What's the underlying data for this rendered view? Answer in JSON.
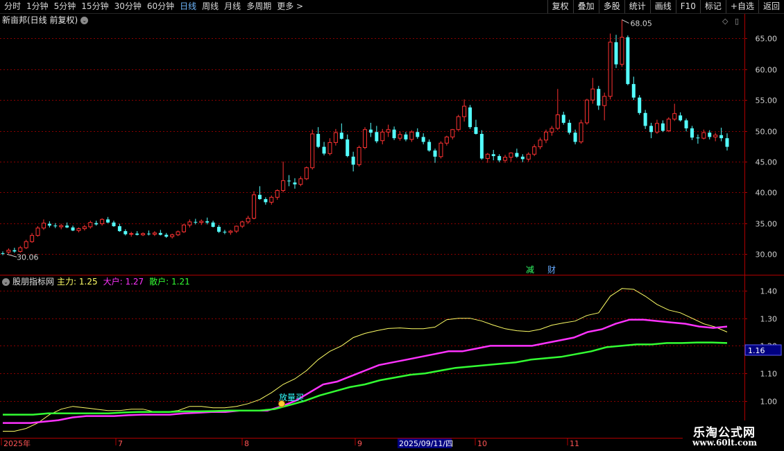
{
  "toolbar": {
    "periods": [
      {
        "label": "分时",
        "active": false
      },
      {
        "label": "1分钟",
        "active": false
      },
      {
        "label": "5分钟",
        "active": false
      },
      {
        "label": "15分钟",
        "active": false
      },
      {
        "label": "30分钟",
        "active": false
      },
      {
        "label": "60分钟",
        "active": false
      },
      {
        "label": "日线",
        "active": true
      },
      {
        "label": "周线",
        "active": false
      },
      {
        "label": "月线",
        "active": false
      },
      {
        "label": "多周期",
        "active": false
      },
      {
        "label": "更多 >",
        "active": false
      }
    ],
    "actions": [
      "复权",
      "叠加",
      "多股",
      "统计",
      "画线",
      "F10",
      "标记",
      "+自选",
      "返回"
    ]
  },
  "stock": {
    "title": "新亩邦(日线 前复权)",
    "high_label": "68.05",
    "low_label": "30.06",
    "event_labels": [
      "减",
      "财"
    ],
    "yaxis_ticks": [
      65,
      60,
      55,
      50,
      45,
      40,
      35,
      30
    ],
    "yaxis_tick_labels": [
      "65.00",
      "60.00",
      "55.00",
      "50.00",
      "45.00",
      "40.00",
      "35.00",
      "30.00"
    ]
  },
  "indicator": {
    "name": "股朋指标网",
    "series_labels": [
      {
        "label": "主力: 1.25",
        "color": "#ffff66"
      },
      {
        "label": "大户: 1.27",
        "color": "#ff33ff"
      },
      {
        "label": "散户: 1.21",
        "color": "#33ff33"
      }
    ],
    "yaxis_ticks": [
      1.4,
      1.3,
      1.2,
      1.1,
      1.0
    ],
    "yaxis_tick_labels": [
      "1.40",
      "1.30",
      "1.20",
      "1.10",
      "1.00"
    ],
    "current_value": "1.16",
    "signal_label": "放量买"
  },
  "xaxis": {
    "labels": [
      "2025年",
      "7",
      "8",
      "9",
      "2025/09/11/四",
      "10",
      "11"
    ],
    "cursor_label": "2025/09/11/四"
  },
  "watermark": {
    "title": "乐淘公式网",
    "url": "www.60lt.com"
  },
  "colors": {
    "up": "#ff3232",
    "down": "#54ffff",
    "main": "#ffff66",
    "big": "#ff33ff",
    "small": "#33ff33",
    "grid": "#8b0000",
    "axis": "#b00000"
  },
  "chart_data": [
    {
      "type": "candlestick",
      "title": "新亩邦(日线 前复权)",
      "ylim": [
        28.5,
        69
      ],
      "markers": {
        "high": 68.05,
        "low": 30.06
      },
      "candles": [
        [
          30.1,
          30.4,
          29.8,
          30.06
        ],
        [
          30.3,
          30.9,
          30.0,
          30.6
        ],
        [
          30.6,
          31.0,
          30.2,
          30.4
        ],
        [
          30.4,
          31.3,
          30.2,
          31.0
        ],
        [
          31.0,
          32.3,
          30.8,
          32.0
        ],
        [
          32.0,
          33.4,
          31.8,
          33.0
        ],
        [
          33.0,
          34.5,
          32.8,
          34.2
        ],
        [
          34.2,
          35.6,
          33.9,
          35.0
        ],
        [
          34.9,
          35.3,
          34.3,
          34.6
        ],
        [
          34.6,
          35.0,
          34.2,
          34.5
        ],
        [
          34.4,
          34.9,
          34.0,
          34.6
        ],
        [
          34.6,
          35.1,
          34.2,
          34.3
        ],
        [
          34.3,
          34.6,
          33.7,
          33.8
        ],
        [
          33.8,
          34.3,
          33.5,
          34.1
        ],
        [
          34.1,
          34.7,
          33.8,
          34.4
        ],
        [
          34.4,
          35.4,
          34.1,
          35.1
        ],
        [
          35.0,
          35.4,
          34.6,
          34.8
        ],
        [
          34.9,
          35.8,
          34.6,
          35.6
        ],
        [
          35.6,
          36.0,
          35.0,
          35.1
        ],
        [
          35.1,
          35.4,
          34.4,
          34.5
        ],
        [
          34.5,
          34.9,
          33.6,
          33.7
        ],
        [
          33.7,
          34.0,
          33.0,
          33.2
        ],
        [
          33.2,
          33.6,
          32.8,
          33.3
        ],
        [
          33.3,
          33.7,
          33.0,
          33.1
        ],
        [
          33.1,
          33.5,
          32.9,
          33.3
        ],
        [
          33.3,
          33.8,
          33.0,
          33.2
        ],
        [
          33.2,
          33.7,
          32.9,
          33.4
        ],
        [
          33.4,
          33.9,
          33.0,
          33.1
        ],
        [
          33.1,
          33.4,
          32.6,
          32.8
        ],
        [
          32.8,
          33.3,
          32.5,
          33.1
        ],
        [
          33.1,
          33.8,
          32.9,
          33.6
        ],
        [
          33.6,
          34.9,
          33.4,
          34.7
        ],
        [
          34.7,
          35.6,
          34.3,
          35.2
        ],
        [
          35.2,
          35.7,
          34.8,
          35.1
        ],
        [
          35.1,
          35.6,
          34.7,
          35.3
        ],
        [
          35.3,
          35.9,
          34.8,
          35.1
        ],
        [
          35.1,
          35.4,
          34.3,
          34.4
        ],
        [
          34.4,
          34.7,
          33.4,
          33.6
        ],
        [
          33.6,
          33.9,
          33.2,
          33.5
        ],
        [
          33.5,
          33.9,
          33.1,
          33.7
        ],
        [
          33.7,
          34.6,
          33.4,
          34.5
        ],
        [
          34.5,
          35.4,
          34.2,
          35.2
        ],
        [
          35.2,
          36.2,
          34.9,
          35.8
        ],
        [
          35.8,
          40.2,
          35.6,
          39.6
        ],
        [
          39.6,
          41.0,
          38.8,
          38.9
        ],
        [
          38.9,
          39.2,
          38.0,
          38.4
        ],
        [
          38.4,
          39.5,
          38.0,
          39.2
        ],
        [
          39.2,
          40.5,
          38.8,
          40.3
        ],
        [
          40.3,
          45.0,
          40.0,
          41.9
        ],
        [
          41.9,
          42.8,
          41.0,
          41.8
        ],
        [
          41.6,
          42.3,
          40.6,
          41.3
        ],
        [
          41.3,
          42.6,
          41.0,
          42.2
        ],
        [
          42.2,
          44.2,
          42.0,
          44.0
        ],
        [
          44.0,
          50.2,
          43.7,
          49.5
        ],
        [
          49.5,
          50.6,
          47.2,
          47.4
        ],
        [
          47.4,
          48.2,
          46.0,
          46.3
        ],
        [
          46.3,
          48.8,
          46.0,
          48.1
        ],
        [
          48.1,
          50.3,
          47.6,
          49.7
        ],
        [
          49.7,
          51.2,
          48.6,
          48.7
        ],
        [
          48.6,
          49.4,
          45.7,
          45.9
        ],
        [
          45.8,
          46.6,
          43.4,
          44.5
        ],
        [
          44.5,
          47.6,
          44.2,
          47.3
        ],
        [
          47.3,
          50.6,
          47.0,
          50.2
        ],
        [
          50.2,
          51.3,
          49.0,
          49.7
        ],
        [
          49.8,
          50.8,
          48.0,
          48.3
        ],
        [
          48.4,
          50.3,
          47.8,
          49.8
        ],
        [
          49.8,
          51.0,
          49.0,
          50.2
        ],
        [
          50.2,
          50.7,
          48.5,
          48.8
        ],
        [
          48.8,
          49.9,
          48.4,
          49.4
        ],
        [
          49.4,
          49.8,
          48.3,
          48.6
        ],
        [
          48.6,
          50.1,
          48.2,
          49.8
        ],
        [
          49.8,
          50.4,
          48.7,
          49.0
        ],
        [
          49.0,
          49.6,
          47.8,
          48.2
        ],
        [
          48.2,
          48.6,
          46.6,
          46.8
        ],
        [
          46.8,
          47.1,
          44.8,
          45.8
        ],
        [
          45.8,
          48.3,
          45.5,
          48.0
        ],
        [
          48.0,
          49.2,
          47.6,
          49.0
        ],
        [
          49.0,
          50.3,
          48.6,
          50.2
        ],
        [
          50.2,
          52.6,
          50.0,
          52.3
        ],
        [
          52.3,
          55.1,
          51.5,
          54.0
        ],
        [
          53.8,
          54.2,
          50.3,
          50.6
        ],
        [
          50.6,
          51.8,
          49.4,
          49.5
        ],
        [
          49.5,
          50.1,
          45.3,
          45.5
        ],
        [
          45.5,
          46.4,
          44.8,
          46.2
        ],
        [
          46.2,
          46.9,
          45.2,
          45.9
        ],
        [
          45.9,
          46.2,
          44.9,
          45.2
        ],
        [
          45.2,
          46.1,
          44.8,
          45.7
        ],
        [
          45.7,
          46.5,
          45.0,
          46.4
        ],
        [
          46.4,
          47.1,
          45.6,
          45.8
        ],
        [
          45.8,
          46.2,
          44.9,
          45.4
        ],
        [
          45.4,
          46.5,
          45.0,
          46.2
        ],
        [
          46.2,
          47.8,
          45.9,
          47.4
        ],
        [
          47.4,
          48.9,
          47.0,
          48.5
        ],
        [
          48.5,
          50.2,
          48.0,
          49.8
        ],
        [
          49.8,
          50.8,
          49.2,
          50.4
        ],
        [
          50.4,
          56.8,
          50.1,
          52.6
        ],
        [
          52.6,
          53.1,
          51.0,
          51.3
        ],
        [
          51.3,
          51.8,
          49.4,
          49.7
        ],
        [
          49.7,
          50.2,
          47.8,
          48.2
        ],
        [
          48.2,
          51.8,
          47.9,
          51.3
        ],
        [
          51.3,
          55.2,
          51.0,
          55.0
        ],
        [
          55.0,
          58.6,
          54.4,
          56.8
        ],
        [
          56.8,
          57.3,
          53.4,
          54.1
        ],
        [
          54.1,
          56.2,
          51.7,
          55.6
        ],
        [
          55.6,
          65.8,
          55.1,
          64.4
        ],
        [
          64.4,
          65.6,
          60.2,
          60.8
        ],
        [
          60.8,
          68.05,
          60.4,
          65.2
        ],
        [
          65.2,
          65.5,
          57.4,
          57.6
        ],
        [
          57.6,
          58.8,
          55.0,
          55.4
        ],
        [
          55.4,
          55.8,
          52.6,
          52.9
        ],
        [
          52.9,
          53.4,
          50.3,
          50.8
        ],
        [
          50.8,
          51.3,
          48.8,
          49.8
        ],
        [
          49.8,
          51.8,
          49.5,
          51.2
        ],
        [
          51.2,
          51.7,
          49.8,
          50.0
        ],
        [
          50.0,
          52.2,
          49.8,
          51.9
        ],
        [
          51.9,
          54.4,
          51.6,
          52.8
        ],
        [
          52.5,
          53.0,
          51.5,
          51.7
        ],
        [
          51.7,
          52.0,
          49.9,
          50.4
        ],
        [
          50.4,
          50.8,
          48.5,
          48.9
        ],
        [
          48.9,
          49.4,
          47.9,
          48.8
        ],
        [
          48.8,
          50.2,
          48.6,
          49.7
        ],
        [
          49.7,
          50.1,
          48.6,
          49.0
        ],
        [
          49.0,
          49.7,
          48.3,
          49.3
        ],
        [
          49.3,
          50.5,
          48.3,
          48.8
        ],
        [
          48.8,
          49.6,
          46.8,
          47.4
        ]
      ]
    },
    {
      "type": "line",
      "title": "股朋指标网",
      "ylim": [
        0.92,
        1.45
      ],
      "series": [
        {
          "name": "主力",
          "values": [
            0.89,
            0.89,
            0.9,
            0.92,
            0.95,
            0.97,
            0.98,
            0.975,
            0.97,
            0.965,
            0.965,
            0.97,
            0.97,
            0.96,
            0.96,
            0.965,
            0.98,
            0.98,
            0.975,
            0.975,
            0.98,
            0.99,
            1.005,
            1.03,
            1.06,
            1.08,
            1.11,
            1.15,
            1.18,
            1.2,
            1.23,
            1.245,
            1.255,
            1.263,
            1.265,
            1.262,
            1.262,
            1.268,
            1.295,
            1.3,
            1.3,
            1.29,
            1.275,
            1.262,
            1.255,
            1.252,
            1.26,
            1.275,
            1.283,
            1.29,
            1.31,
            1.32,
            1.38,
            1.408,
            1.405,
            1.38,
            1.35,
            1.33,
            1.32,
            1.3,
            1.28,
            1.268,
            1.25
          ]
        },
        {
          "name": "大户",
          "values": [
            0.92,
            0.92,
            0.92,
            0.925,
            0.93,
            0.94,
            0.945,
            0.945,
            0.945,
            0.948,
            0.95,
            0.95,
            0.95,
            0.955,
            0.957,
            0.96,
            0.96,
            0.965,
            0.965,
            0.965,
            0.98,
            1.0,
            1.03,
            1.06,
            1.07,
            1.09,
            1.11,
            1.13,
            1.14,
            1.15,
            1.16,
            1.17,
            1.18,
            1.18,
            1.19,
            1.2,
            1.2,
            1.2,
            1.2,
            1.21,
            1.22,
            1.23,
            1.25,
            1.26,
            1.28,
            1.295,
            1.295,
            1.29,
            1.285,
            1.28,
            1.27,
            1.265,
            1.27
          ]
        },
        {
          "name": "散户",
          "values": [
            0.95,
            0.95,
            0.95,
            0.955,
            0.955,
            0.955,
            0.955,
            0.955,
            0.958,
            0.96,
            0.96,
            0.96,
            0.962,
            0.962,
            0.963,
            0.965,
            0.965,
            0.965,
            0.97,
            0.985,
            1.0,
            1.02,
            1.035,
            1.05,
            1.06,
            1.075,
            1.085,
            1.095,
            1.1,
            1.11,
            1.12,
            1.125,
            1.13,
            1.135,
            1.14,
            1.15,
            1.155,
            1.16,
            1.17,
            1.18,
            1.195,
            1.2,
            1.205,
            1.205,
            1.21,
            1.21,
            1.212,
            1.212,
            1.21
          ]
        }
      ]
    }
  ]
}
